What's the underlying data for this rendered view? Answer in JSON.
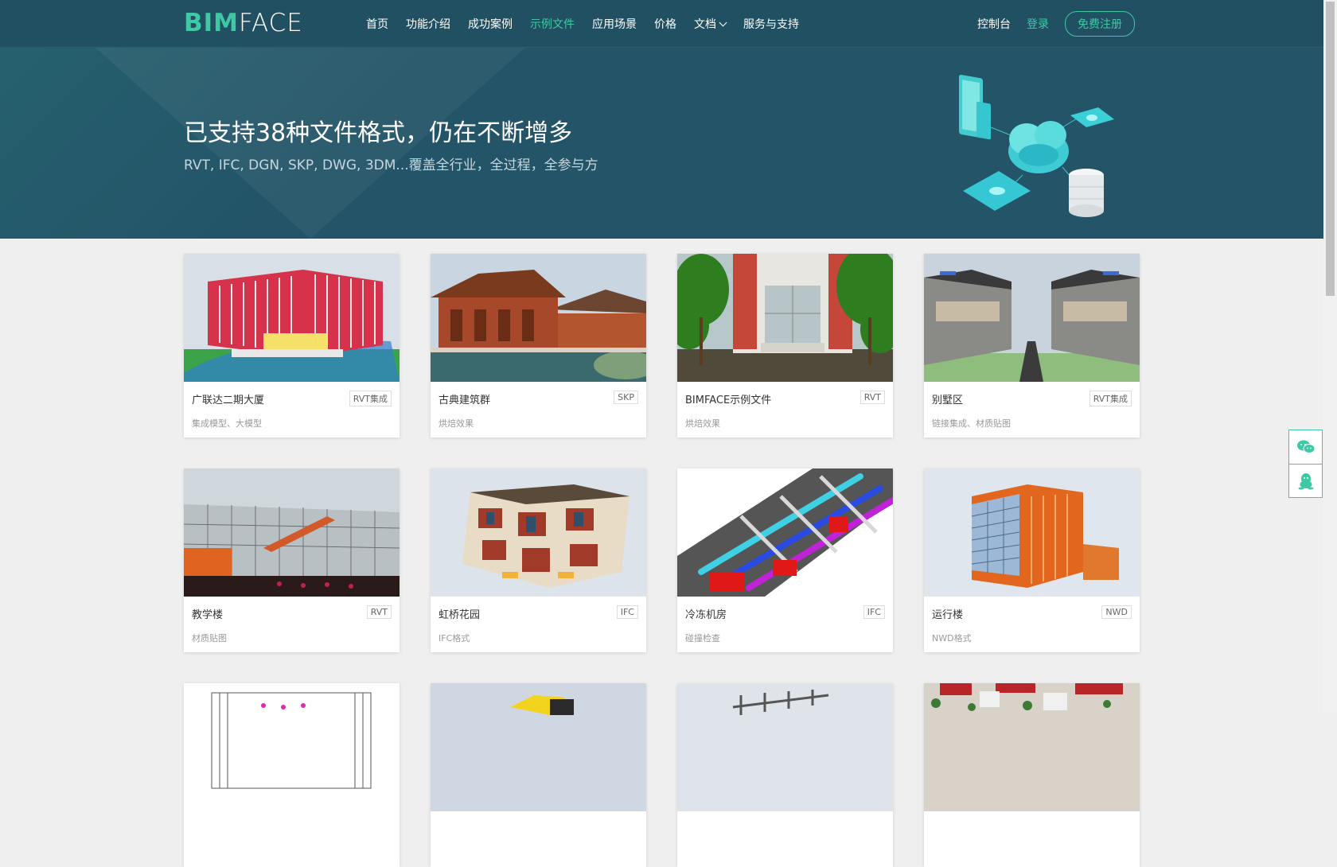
{
  "header": {
    "logo": {
      "part1": "BIM",
      "part2": "FACE"
    },
    "nav": [
      {
        "label": "首页",
        "active": false
      },
      {
        "label": "功能介绍",
        "active": false
      },
      {
        "label": "成功案例",
        "active": false
      },
      {
        "label": "示例文件",
        "active": true
      },
      {
        "label": "应用场景",
        "active": false
      },
      {
        "label": "价格",
        "active": false
      },
      {
        "label": "文档",
        "active": false,
        "dropdown": true
      },
      {
        "label": "服务与支持",
        "active": false
      }
    ],
    "console": "控制台",
    "login": "登录",
    "register": "免费注册"
  },
  "hero": {
    "title": "已支持38种文件格式，仍在不断增多",
    "subtitle": "RVT, IFC, DGN, SKP, DWG, 3DM...覆盖全行业，全过程，全参与方"
  },
  "cards": [
    {
      "name": "广联达二期大厦",
      "tag": "RVT集成",
      "desc": "集成模型、大模型",
      "thumb": "office-building"
    },
    {
      "name": "古典建筑群",
      "tag": "SKP",
      "desc": "烘焙效果",
      "thumb": "classical-building"
    },
    {
      "name": "BIMFACE示例文件",
      "tag": "RVT",
      "desc": "烘焙效果",
      "thumb": "trees-entrance"
    },
    {
      "name": "别墅区",
      "tag": "RVT集成",
      "desc": "链接集成、材质贴图",
      "thumb": "villa-street"
    },
    {
      "name": "教学楼",
      "tag": "RVT",
      "desc": "材质贴图",
      "thumb": "teaching-building"
    },
    {
      "name": "虹桥花园",
      "tag": "IFC",
      "desc": "IFC格式",
      "thumb": "garden-house"
    },
    {
      "name": "冷冻机房",
      "tag": "IFC",
      "desc": "碰撞检查",
      "thumb": "mep-pipes"
    },
    {
      "name": "运行楼",
      "tag": "NWD",
      "desc": "NWD格式",
      "thumb": "orange-tower"
    },
    {
      "name": "",
      "tag": "",
      "desc": "",
      "thumb": "drawing"
    },
    {
      "name": "",
      "tag": "",
      "desc": "",
      "thumb": "excavator"
    },
    {
      "name": "",
      "tag": "",
      "desc": "",
      "thumb": "steel-frame"
    },
    {
      "name": "",
      "tag": "",
      "desc": "",
      "thumb": "city-block"
    }
  ],
  "floating": {
    "wechat_icon": "wechat-icon",
    "qq_icon": "qq-icon"
  },
  "colors": {
    "header_bg": "#215063",
    "accent": "#3ec9a4",
    "page_bg": "#efefef"
  }
}
